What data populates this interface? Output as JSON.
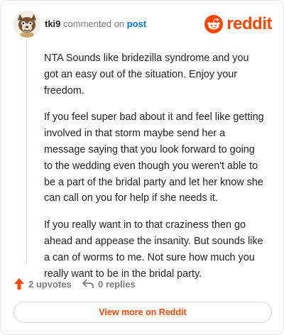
{
  "header": {
    "username": "tki9",
    "action_text": "commented on",
    "post_link": "post",
    "brand": "reddit"
  },
  "comment": {
    "paragraphs": [
      "NTA Sounds like bridezilla syndrome and you got an easy out of the situation. Enjoy your freedom.",
      "If you feel super bad about it and feel like getting involved in that storm maybe send her a message saying that you look forward to going to the wedding even though you weren't able to be a part of the bridal party and let her know she can call on you for help if she needs it.",
      "If you really want in to that craziness then go ahead and appease the insanity. But sounds like a can of worms to me. Not sure how much you really want to be in the bridal party."
    ]
  },
  "actions": {
    "upvotes": "2 upvotes",
    "replies": "0 replies"
  },
  "footer": {
    "view_more": "View more on Reddit"
  },
  "colors": {
    "brand": "#ff4500",
    "link": "#0079d3",
    "muted": "#7c7c7c"
  },
  "icons": [
    "user-avatar",
    "reddit-logo-icon",
    "upvote-arrow-icon",
    "reply-arrow-icon"
  ]
}
